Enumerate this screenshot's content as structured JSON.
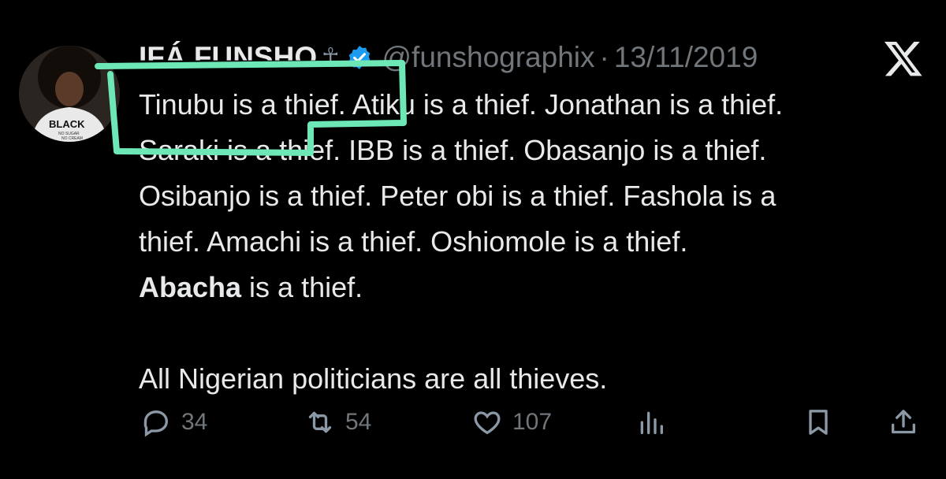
{
  "tweet": {
    "author_name": "IFÁ FUNSHO",
    "ankh_glyph": "☥",
    "handle": "@funshographix",
    "separator": "·",
    "date": "13/11/2019",
    "lines": [
      "Tinubu is a thief. Atiku is a thief. Jonathan is a thief.",
      "Saraki is a thief. IBB is a thief. Obasanjo is a thief.",
      "Osibanjo is a thief. Peter obi is a thief. Fashola is a",
      "thief. Amachi is a thief. Oshiomole is a thief."
    ],
    "bold_word": "Abacha",
    "last_line_rest": " is a thief.",
    "closing_line": "All Nigerian politicians are all thieves."
  },
  "avatar": {
    "shirt_text": "BLACK",
    "shirt_sub1": "NO SUGAR",
    "shirt_sub2": "NO CREAM"
  },
  "actions": {
    "replies": "34",
    "reposts": "54",
    "likes": "107"
  },
  "colors": {
    "background": "#000000",
    "text": "#e7e9ea",
    "muted": "#71767b",
    "verified": "#1d9bf0",
    "highlight": "#6ee7b7"
  }
}
